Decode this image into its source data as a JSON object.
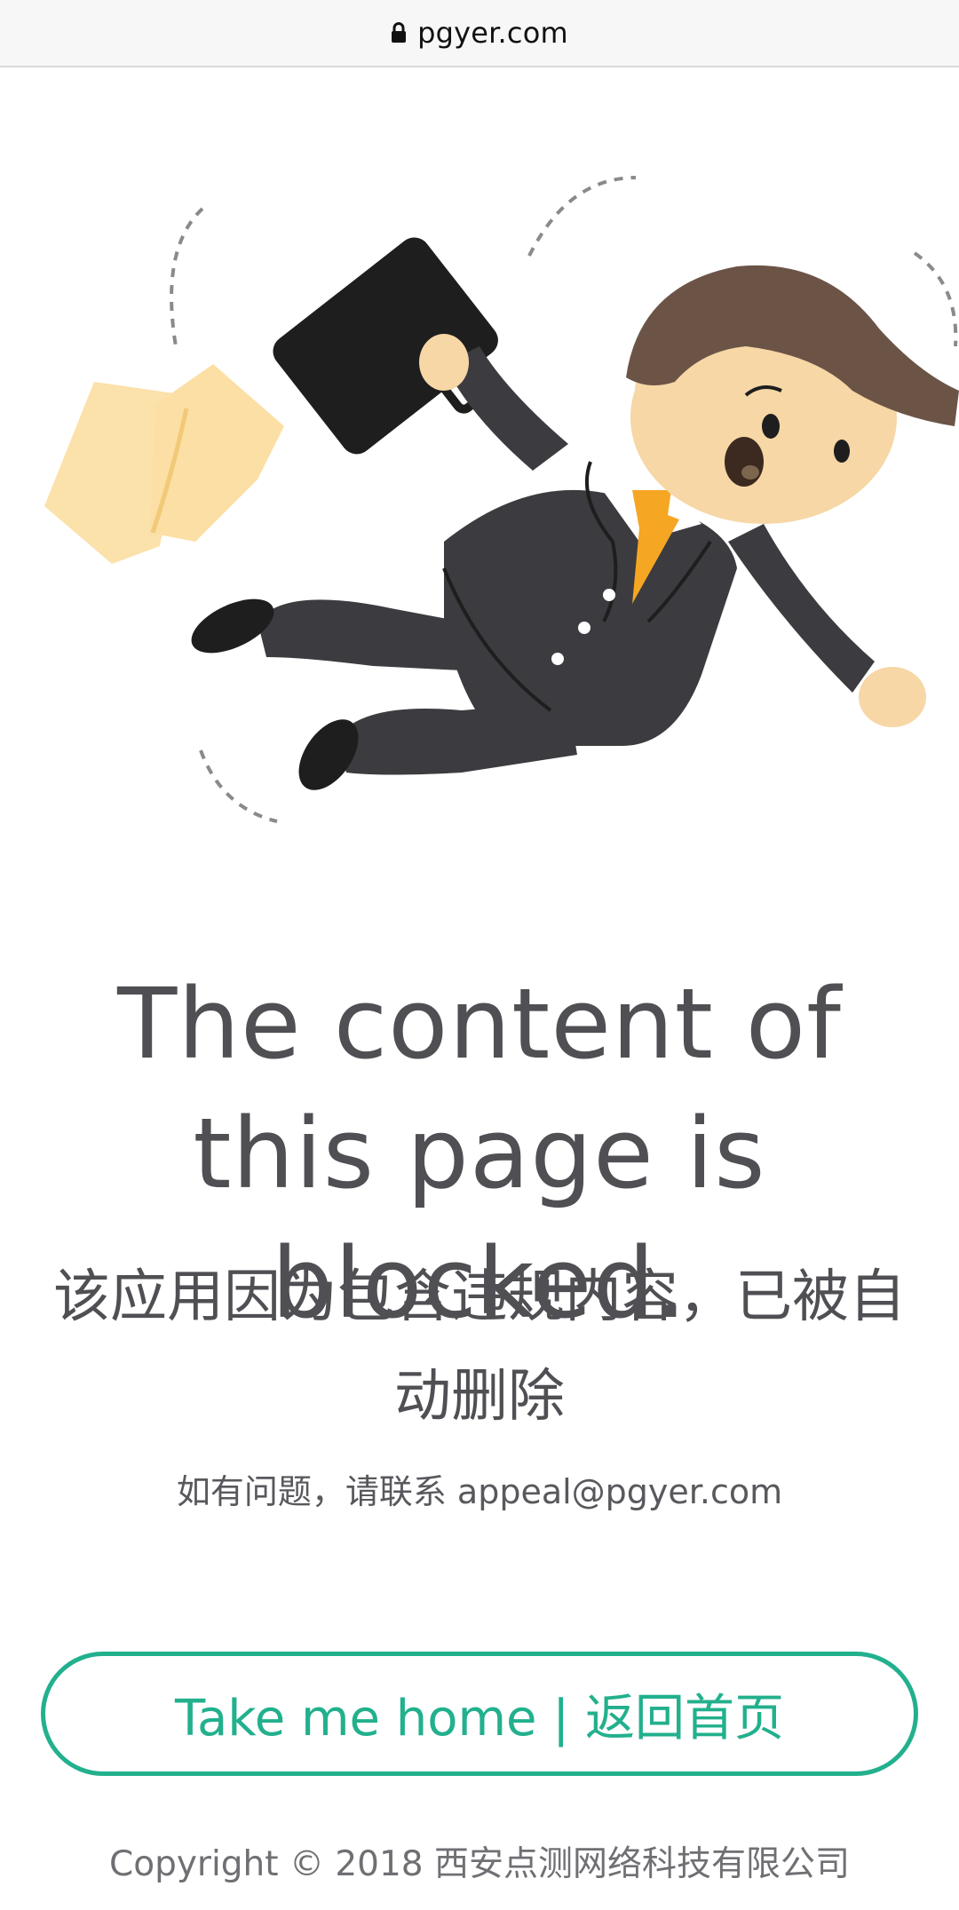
{
  "browser": {
    "domain": "pgyer.com",
    "lock_icon": "lock-icon"
  },
  "illustration": {
    "description_icon": "falling-businessman-illustration",
    "colors": {
      "suit": "#3c3b3f",
      "skin": "#f6d7a5",
      "hair": "#6b5446",
      "tie": "#f5a623",
      "briefcase": "#1e1e1f",
      "papers": "#fbe1aa"
    }
  },
  "main": {
    "title": "The content of this page is blocked.",
    "subtitle": "该应用因为包含违规内容，已被自动删除",
    "contact": "如有问题，请联系 appeal@pgyer.com",
    "home_button": "Take me home | 返回首页"
  },
  "footer": {
    "copyright": "Copyright © 2018 西安点测网络科技有限公司"
  },
  "colors": {
    "accent": "#22b08d",
    "text": "#4f4f54"
  }
}
